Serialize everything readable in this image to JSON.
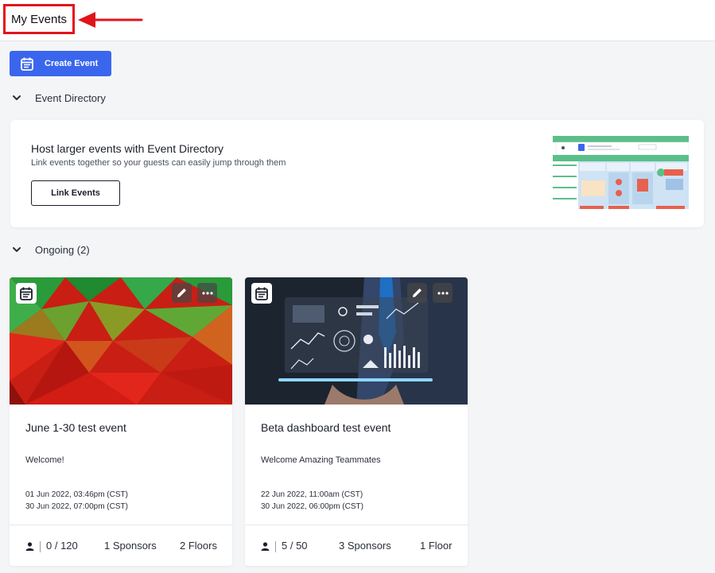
{
  "header": {
    "title": "My Events"
  },
  "toolbar": {
    "create_label": "Create Event"
  },
  "sections": {
    "directory_label": "Event Directory",
    "ongoing_label": "Ongoing (2)"
  },
  "promo": {
    "title": "Host larger events with Event Directory",
    "subtitle": "Link events together so your guests can easily jump through them",
    "button_label": "Link Events"
  },
  "events": [
    {
      "name": "June 1-30 test event",
      "description": "Welcome!",
      "start": "01 Jun 2022, 03:46pm (CST)",
      "end": "30 Jun 2022, 07:00pm (CST)",
      "attendees": "0 / 120",
      "sponsors": "1 Sponsors",
      "floors": "2 Floors"
    },
    {
      "name": "Beta dashboard test event",
      "description": "Welcome Amazing Teammates",
      "start": "22 Jun 2022, 11:00am (CST)",
      "end": "30 Jun 2022, 06:00pm (CST)",
      "attendees": "5 / 50",
      "sponsors": "3 Sponsors",
      "floors": "1 Floor"
    }
  ],
  "colors": {
    "accent": "#3a66ee",
    "highlight": "#e1141c",
    "background": "#f4f5f7"
  },
  "icons": {
    "calendar": "calendar-icon",
    "edit": "pencil-icon",
    "more": "more-dots-icon",
    "chevron": "chevron-down-icon",
    "person": "person-icon"
  }
}
